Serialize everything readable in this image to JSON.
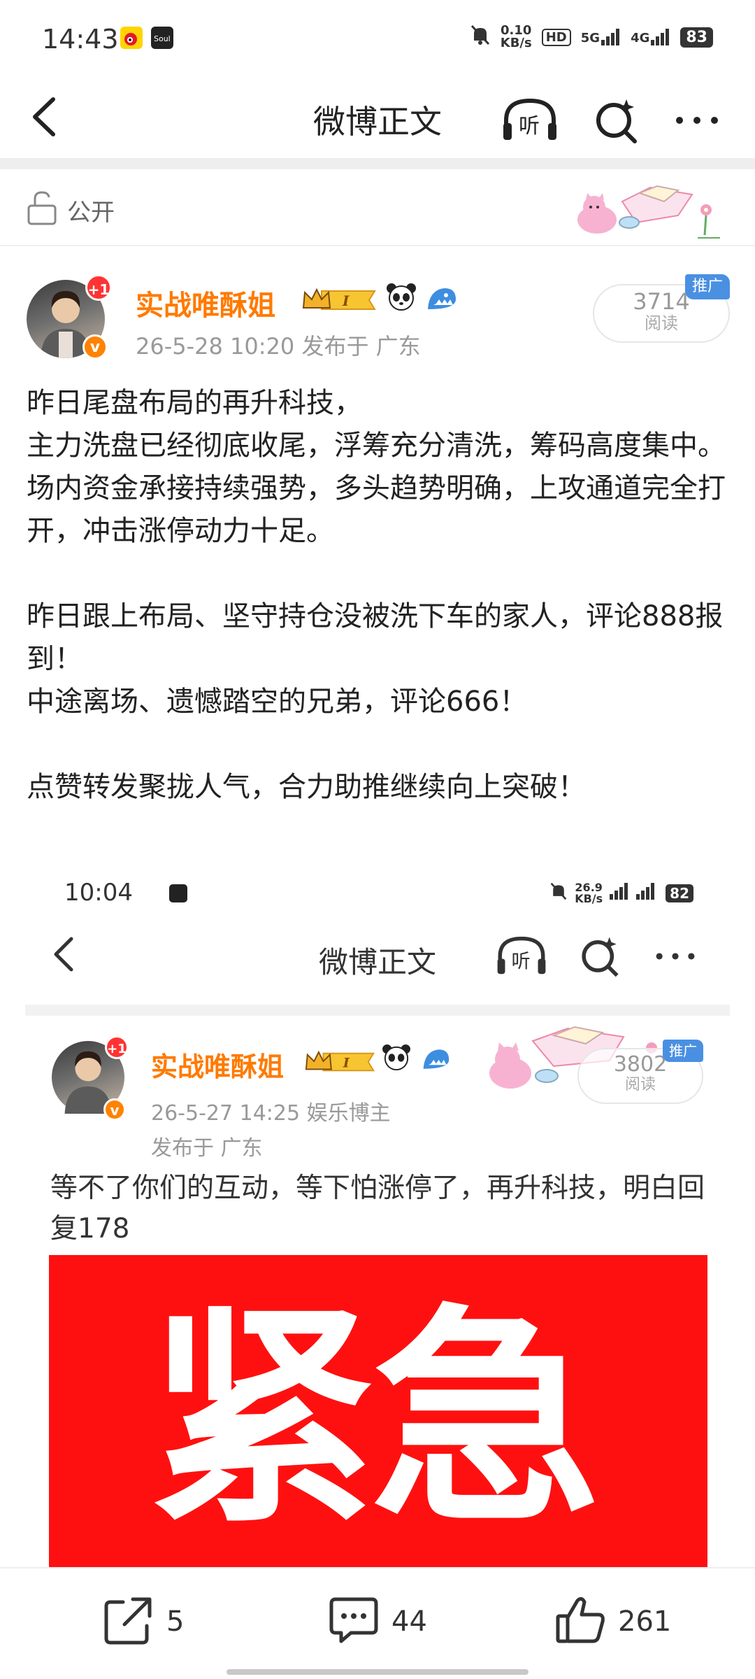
{
  "status_bar": {
    "time": "14:43",
    "net_speed_value": "0.10",
    "net_speed_unit": "KB/s",
    "hd_label": "HD",
    "net_5g": "5G",
    "net_4g": "4G",
    "battery": "83"
  },
  "nav": {
    "title": "微博正文",
    "listen_icon_text": "听"
  },
  "visibility": {
    "label": "公开"
  },
  "post": {
    "author": "实战唯酥姐",
    "avatar_badge": "+1",
    "verified_badge": "v",
    "level_badge": "I",
    "meta": "26-5-28 10:20   发布于 广东",
    "read_count": "3714",
    "read_label": "阅读",
    "promo_tag": "推广",
    "paragraphs": [
      "昨日尾盘布局的再升科技，",
      "主力洗盘已经彻底收尾，浮筹充分清洗，筹码高度集中。",
      "场内资金承接持续强势，多头趋势明确，上攻通道完全打开，冲击涨停动力十足。",
      "",
      "昨日跟上布局、坚守持仓没被洗下车的家人，评论888报到！",
      "中途离场、遗憾踏空的兄弟，评论666！",
      "",
      "点赞转发聚拢人气，合力助推继续向上突破！"
    ]
  },
  "embedded": {
    "status_bar": {
      "time": "10:04",
      "net_speed_value": "26.9",
      "net_speed_unit": "KB/s",
      "battery": "82"
    },
    "nav_title": "微博正文",
    "listen_icon_text": "听",
    "author": "实战唯酥姐",
    "avatar_badge": "+1",
    "verified_badge": "v",
    "level_badge": "I",
    "meta_line1": "26-5-27 14:25   娱乐博主",
    "meta_line2": "发布于 广东",
    "read_count": "3802",
    "read_label": "阅读",
    "promo_tag": "推广",
    "text": "等不了你们的互动，等下怕涨停了，再升科技，明白回复178",
    "image_text": "紧急",
    "image_bg_color": "#ff1010"
  },
  "actions": {
    "share_count": "5",
    "comment_count": "44",
    "like_count": "261"
  },
  "colors": {
    "author_name": "#ff7a00",
    "promo_tag": "#4a90e2",
    "verified": "#ff8200",
    "badge_red": "#ff3333"
  }
}
